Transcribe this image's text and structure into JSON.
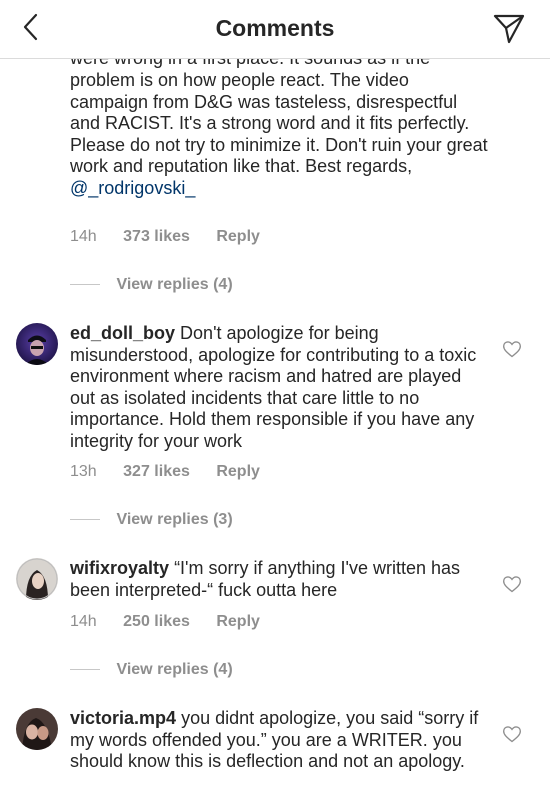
{
  "header": {
    "title": "Comments"
  },
  "first_comment": {
    "clipped_line": "were wrong in a first place. It sounds as if the",
    "text": "problem is on how people react. The video campaign from D&G was tasteless, disrespectful and RACIST. It's a strong word and it fits perfectly. Please do not try to minimize it. Don't ruin your great work and reputation like that. Best regards,",
    "mention": "@_rodrigovski_",
    "time": "14h",
    "likes": "373 likes",
    "reply": "Reply",
    "view_replies": "View replies (4)"
  },
  "comments": [
    {
      "username": "ed_doll_boy",
      "text": "Don't apologize for being misunderstood, apologize for contributing to a toxic environment where racism and hatred are played out as isolated incidents that care little to no importance. Hold them responsible if you have any integrity for your work",
      "time": "13h",
      "likes": "327 likes",
      "reply": "Reply",
      "view_replies": "View replies (3)"
    },
    {
      "username": "wifixroyalty",
      "text": "“I'm sorry if anything I've written has been interpreted-“ fuck outta here",
      "time": "14h",
      "likes": "250 likes",
      "reply": "Reply",
      "view_replies": "View replies (4)"
    },
    {
      "username": "victoria.mp4",
      "text": "you didnt apologize, you said “sorry if my words offended you.” you are a WRITER.  you should know this is deflection and not an apology."
    }
  ],
  "colors": {
    "text": "#262626",
    "secondary": "#8e8e8e",
    "mention": "#003569",
    "divider": "#dbdbdb"
  },
  "icons": {
    "back": "chevron-left-icon",
    "send": "direct-send-icon",
    "like": "heart-outline-icon"
  }
}
